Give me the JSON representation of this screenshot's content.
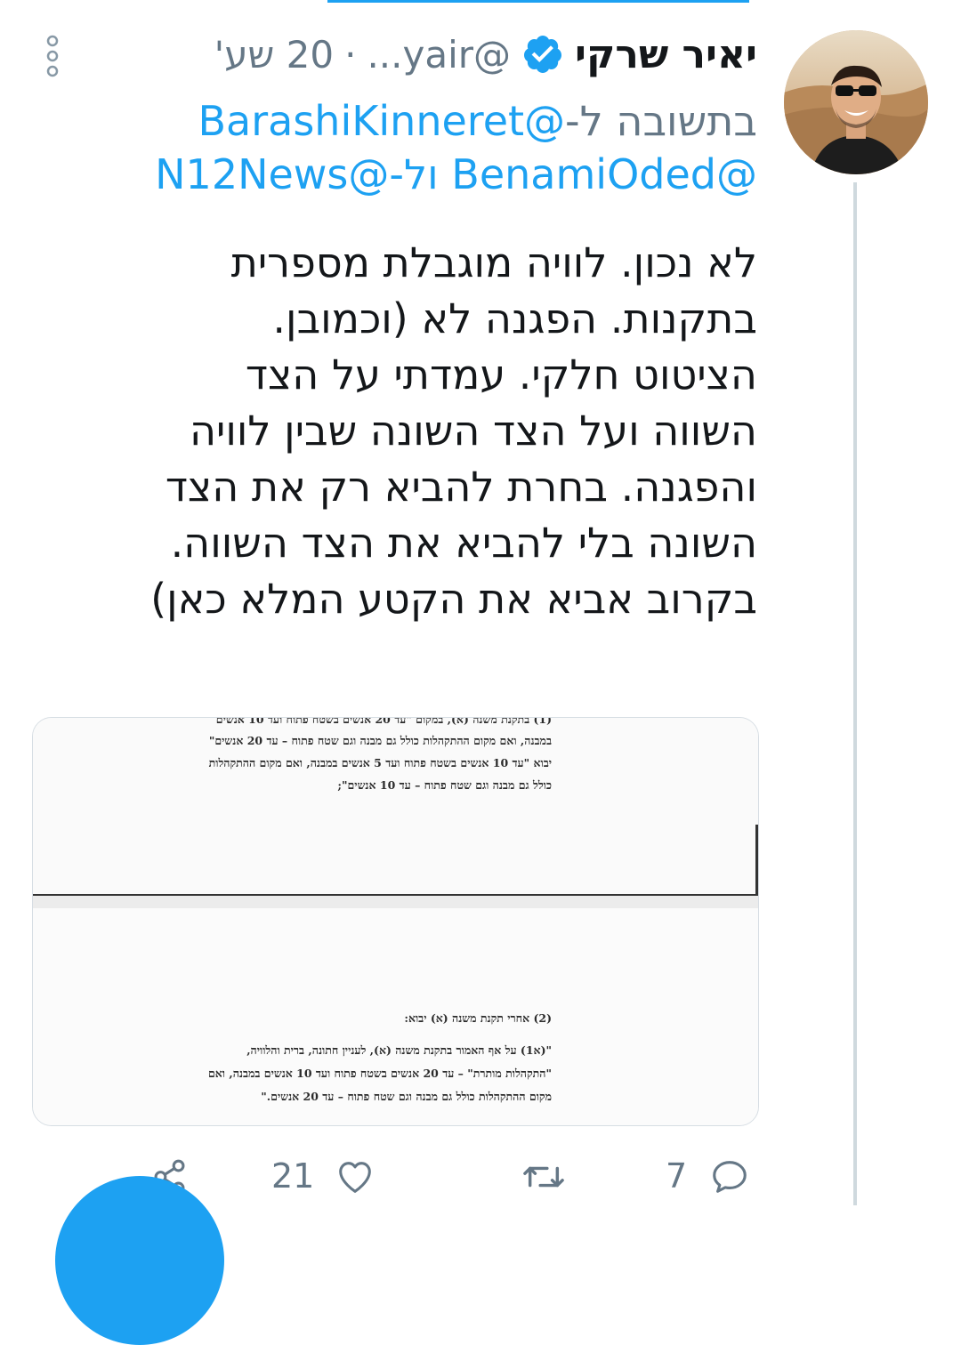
{
  "tweet": {
    "display_name": "יאיר שרקי",
    "handle": "@yair...",
    "dot": "·",
    "time": "20 שע'",
    "reply_prefix": "בתשובה ל-",
    "reply_mention_1": "@BarashiKinneret",
    "reply_mention_2": "@BenamiOded",
    "reply_and": "ול-",
    "reply_mention_3": "@N12News",
    "text": "לא נכון. לוויה מוגבלת מספרית\nבתקנות. הפגנה לא (וכמובן.\nהציטוט חלקי. עמדתי על הצד\nהשווה ועל הצד השונה שבין לוויה\nוהפגנה. בחרת להביא רק את הצד\nהשונה בלי להביא את הצד השווה.\nבקרוב אביא את הקטע המלא כאן)"
  },
  "document": {
    "top_lines": [
      "(1) בתקנת משנה (א), במקום \"עד 20 אנשים בשטח פתוח ועד 10 אנשים",
      "במבנה, ואם מקום ההתקהלות כולל גם מבנה וגם שטח פתוח – עד 20 אנשים\"",
      "יבוא \"עד 10 אנשים בשטח פתוח ועד 5 אנשים במבנה, ואם מקום ההתקהלות",
      "כולל גם מבנה וגם שטח פתוח – עד 10 אנשים\";"
    ],
    "bottom_heading": "(2)    אחרי תקנת משנה (א) יבוא:",
    "bottom_lines": [
      "\"(א1) על אף האמור בתקנת משנה (א), לעניין חתונה, ברית והלוויה,",
      "\"התקהלות מותרת\" – עד 20 אנשים בשטח פתוח ועד 10 אנשים במבנה, ואם",
      "מקום ההתקהלות כולל גם מבנה וגם שטח פתוח – עד 20 אנשים.\""
    ]
  },
  "actions": {
    "reply_count": "7",
    "retweet_count": "",
    "like_count": "21"
  },
  "colors": {
    "accent": "#1da1f2",
    "secondary_text": "#657786",
    "thread_line": "#cfd9de"
  }
}
